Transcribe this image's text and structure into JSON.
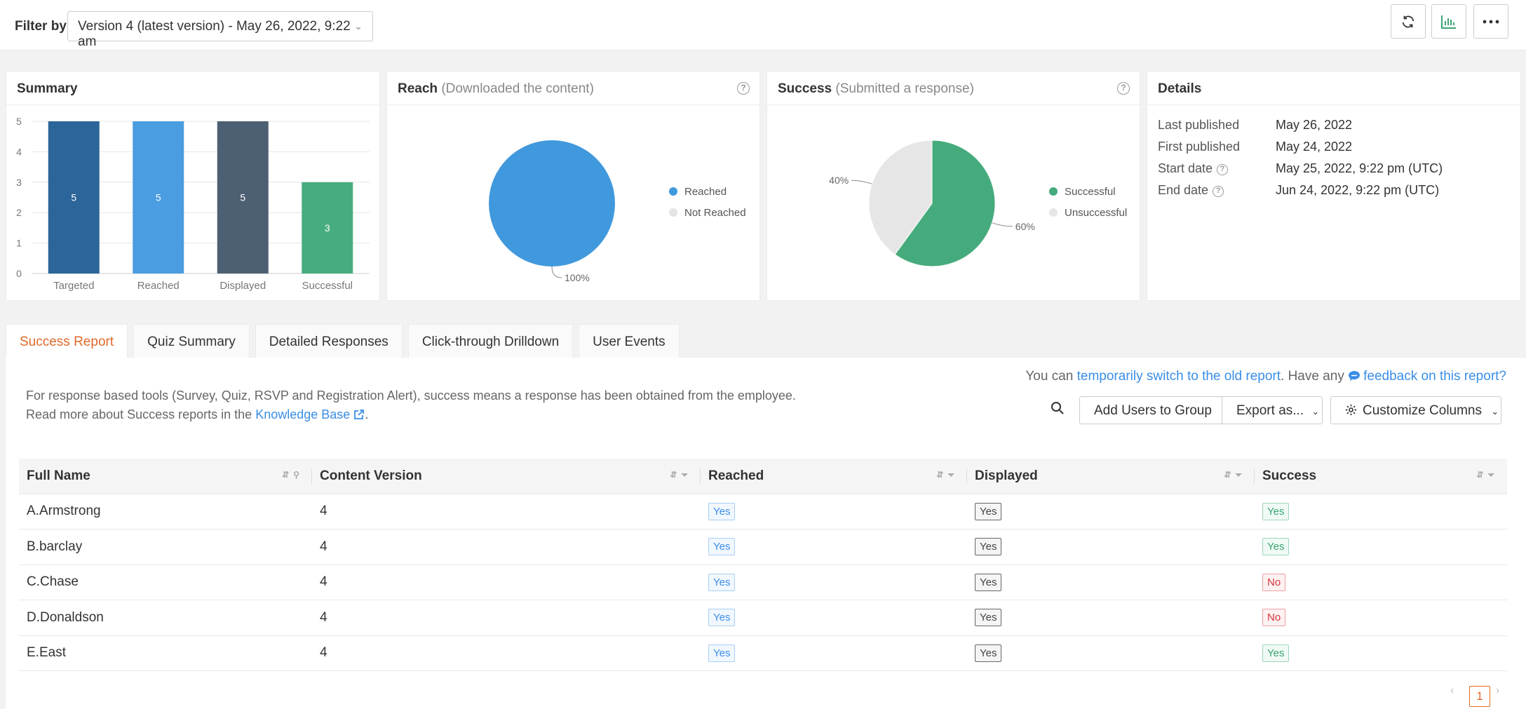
{
  "filter": {
    "label": "Filter by:",
    "selected": "Version 4 (latest version) - May 26, 2022, 9:22 am"
  },
  "toolbar": {
    "icons": [
      "refresh-icon",
      "chart-icon",
      "more-icon"
    ],
    "accent": "#3aa372"
  },
  "summary_card": {
    "title": "Summary",
    "chart_data": {
      "type": "bar",
      "categories": [
        "Targeted",
        "Reached",
        "Displayed",
        "Successful"
      ],
      "values": [
        5,
        5,
        5,
        3
      ],
      "colors": [
        "#2b6599",
        "#4a9de0",
        "#4d5f72",
        "#48ad7e"
      ],
      "ylim": [
        0,
        5
      ],
      "yticks": [
        "0",
        "1",
        "2",
        "3",
        "4",
        "5"
      ],
      "data_labels": [
        "5",
        "5",
        "5",
        "3"
      ]
    }
  },
  "reach_card": {
    "title": "Reach",
    "subtitle": "(Downloaded the content)",
    "chart_data": {
      "type": "pie",
      "labels": [
        "Reached",
        "Not Reached"
      ],
      "values": [
        100,
        0
      ],
      "colors": [
        "#4199dd",
        "#e4e4e4"
      ],
      "data_labels": [
        "100%"
      ]
    },
    "legend": [
      "Reached",
      "Not Reached"
    ]
  },
  "success_card": {
    "title": "Success",
    "subtitle": "(Submitted a response)",
    "chart_data": {
      "type": "pie",
      "labels": [
        "Successful",
        "Unsuccessful"
      ],
      "values": [
        60,
        40
      ],
      "colors": [
        "#46ab7c",
        "#e6e6e6"
      ],
      "data_labels": [
        "60%",
        "40%"
      ]
    },
    "legend": [
      "Successful",
      "Unsuccessful"
    ]
  },
  "details_card": {
    "title": "Details",
    "rows": [
      {
        "label": "Last published",
        "value": "May 26, 2022"
      },
      {
        "label": "First published",
        "value": "May 24, 2022"
      },
      {
        "label": "Start date",
        "value": "May 25, 2022, 9:22 pm (UTC)"
      },
      {
        "label": "End date",
        "value": "Jun 24, 2022, 9:22 pm (UTC)"
      }
    ]
  },
  "tabs": [
    "Success Report",
    "Quiz Summary",
    "Detailed Responses",
    "Click-through Drilldown",
    "User Events"
  ],
  "notice": {
    "prefix": "You can ",
    "link1": "temporarily switch to the old report",
    "middle": ". Have any ",
    "link2": "feedback on this report?"
  },
  "description": {
    "line1": "For response based tools (Survey, Quiz, RSVP and Registration Alert), success means a response has been obtained from the employee.",
    "line2_prefix": "Read more about Success reports in the ",
    "line2_link": "Knowledge Base",
    "line2_suffix": "."
  },
  "actions": {
    "add_users": "Add Users to Group",
    "export": "Export as...",
    "customize": "Customize Columns"
  },
  "table": {
    "columns": [
      "Full Name",
      "Content Version",
      "Reached",
      "Displayed",
      "Success"
    ],
    "rows": [
      {
        "name": "A.Armstrong",
        "version": "4",
        "reached": "Yes",
        "displayed": "Yes",
        "success": "Yes"
      },
      {
        "name": "B.barclay",
        "version": "4",
        "reached": "Yes",
        "displayed": "Yes",
        "success": "Yes"
      },
      {
        "name": "C.Chase",
        "version": "4",
        "reached": "Yes",
        "displayed": "Yes",
        "success": "No"
      },
      {
        "name": "D.Donaldson",
        "version": "4",
        "reached": "Yes",
        "displayed": "Yes",
        "success": "No"
      },
      {
        "name": "E.East",
        "version": "4",
        "reached": "Yes",
        "displayed": "Yes",
        "success": "Yes"
      }
    ]
  },
  "pagination": {
    "current": "1",
    "prev": "‹",
    "next": "›"
  }
}
